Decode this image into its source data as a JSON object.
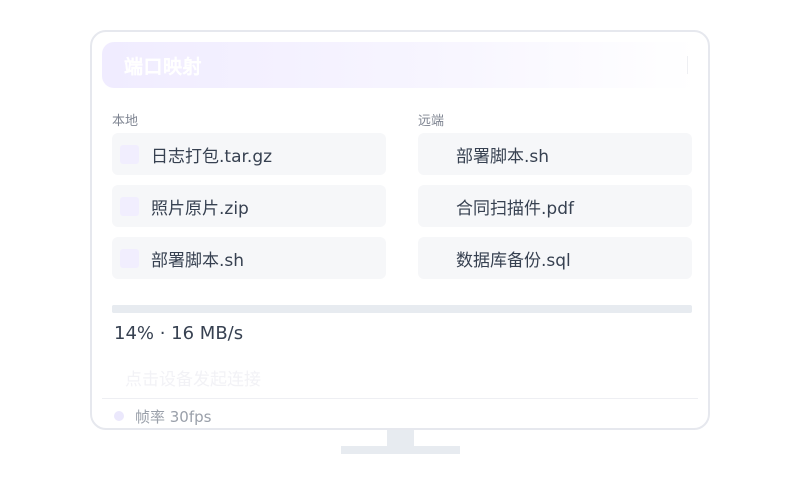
{
  "window": {
    "title": "端口映射"
  },
  "local": {
    "label": "本地",
    "items": [
      {
        "name": "日志打包.tar.gz"
      },
      {
        "name": "照片原片.zip"
      },
      {
        "name": "部署脚本.sh"
      }
    ]
  },
  "remote": {
    "label": "远端",
    "items": [
      {
        "name": "部署脚本.sh"
      },
      {
        "name": "合同扫描件.pdf"
      },
      {
        "name": "数据库备份.sql"
      }
    ]
  },
  "transfer": {
    "percent": 14,
    "label": "14% · 16 MB/s"
  },
  "connect": {
    "label": "点击设备发起连接"
  },
  "status": {
    "label": "帧率 30fps"
  },
  "colors": {
    "header_gradient_start": "#f0ecff",
    "file_icon": "#f1eefe",
    "track": "#e7ebf0",
    "status_dot": "#ebe8fc"
  }
}
